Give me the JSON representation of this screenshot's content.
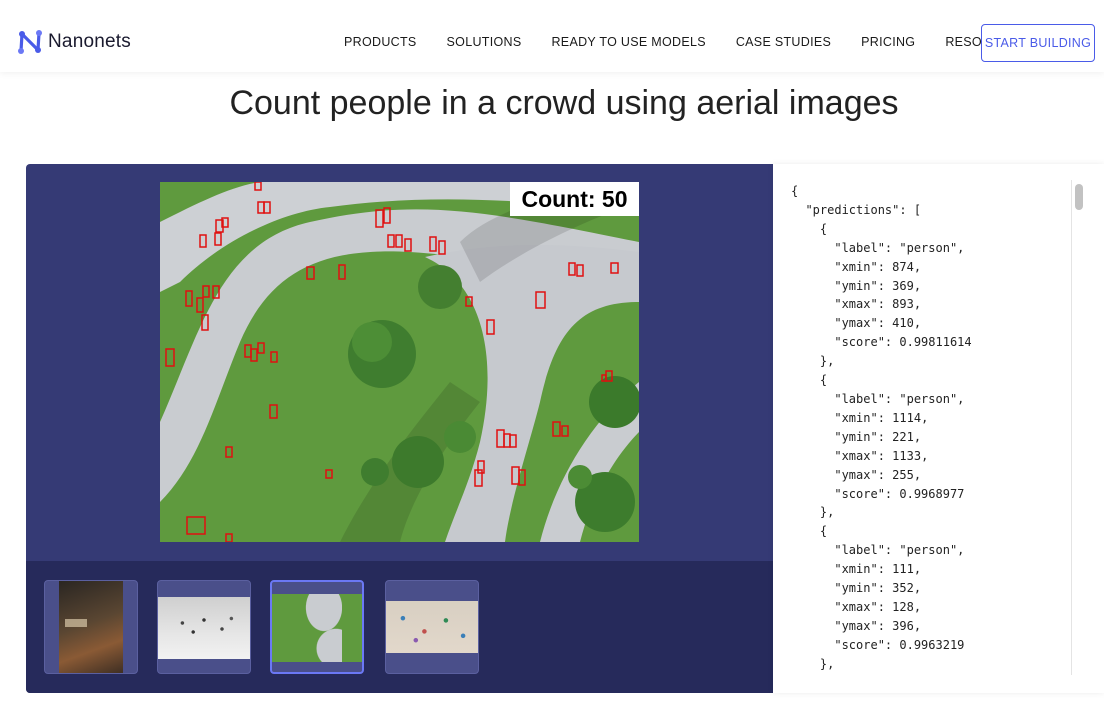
{
  "brand": {
    "name": "Nanonets",
    "accent": "#4a5be8"
  },
  "nav": {
    "items": [
      "PRODUCTS",
      "SOLUTIONS",
      "READY TO USE MODELS",
      "CASE STUDIES",
      "PRICING",
      "RESOURCES"
    ],
    "cta": "START BUILDING"
  },
  "page_title": "Count people in a crowd using aerial images",
  "demo": {
    "count_label": "Count: 50",
    "thumbnails": [
      {
        "name": "street-night",
        "selected": false
      },
      {
        "name": "plaza-crowd",
        "selected": false
      },
      {
        "name": "park-aerial",
        "selected": true
      },
      {
        "name": "beach-crowd",
        "selected": false
      }
    ]
  },
  "json_output": {
    "open_brace": "{",
    "predictions_key": "\"predictions\": [",
    "predictions": [
      {
        "label": "\"person\"",
        "xmin": "874",
        "ymin": "369",
        "xmax": "893",
        "ymax": "410",
        "score": "0.99811614"
      },
      {
        "label": "\"person\"",
        "xmin": "1114",
        "ymin": "221",
        "xmax": "1133",
        "ymax": "255",
        "score": "0.9968977"
      },
      {
        "label": "\"person\"",
        "xmin": "111",
        "ymin": "352",
        "xmax": "128",
        "ymax": "396",
        "score": "0.9963219"
      }
    ]
  },
  "colors": {
    "panel": "#353a75",
    "thumbbar": "#262a5b",
    "box": "#e01010",
    "grass": "#5f9a3e",
    "path": "#c9ccd0"
  }
}
